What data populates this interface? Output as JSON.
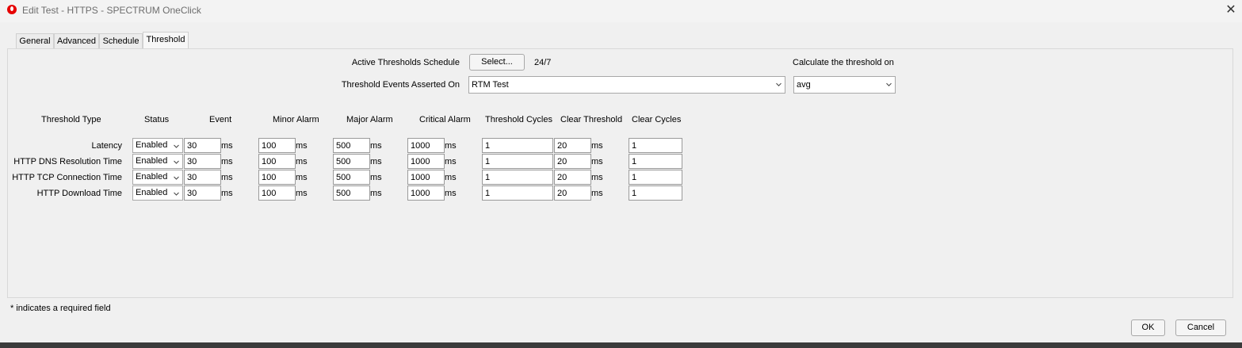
{
  "window": {
    "title": "Edit Test - HTTPS - SPECTRUM OneClick"
  },
  "tabs": [
    {
      "label": "General"
    },
    {
      "label": "Advanced"
    },
    {
      "label": "Schedule"
    },
    {
      "label": "Threshold",
      "active": true
    }
  ],
  "schedule": {
    "label": "Active Thresholds Schedule",
    "select_button": "Select...",
    "value": "24/7"
  },
  "asserted": {
    "label": "Threshold Events Asserted On",
    "value": "RTM Test"
  },
  "calculate": {
    "label": "Calculate the threshold on",
    "value": "avg"
  },
  "table": {
    "headers": {
      "type": "Threshold Type",
      "status": "Status",
      "event": "Event",
      "minor": "Minor Alarm",
      "major": "Major Alarm",
      "critical": "Critical Alarm",
      "cycles": "Threshold Cycles",
      "clear": "Clear Threshold",
      "clear_cycles": "Clear Cycles"
    },
    "unit": "ms",
    "rows": [
      {
        "type": "Latency",
        "status": "Enabled",
        "event": "30",
        "minor": "100",
        "major": "500",
        "critical": "1000",
        "cycles": "1",
        "clear": "20",
        "clear_cycles": "1"
      },
      {
        "type": "HTTP DNS Resolution Time",
        "status": "Enabled",
        "event": "30",
        "minor": "100",
        "major": "500",
        "critical": "1000",
        "cycles": "1",
        "clear": "20",
        "clear_cycles": "1"
      },
      {
        "type": "HTTP TCP Connection Time",
        "status": "Enabled",
        "event": "30",
        "minor": "100",
        "major": "500",
        "critical": "1000",
        "cycles": "1",
        "clear": "20",
        "clear_cycles": "1"
      },
      {
        "type": "HTTP Download Time",
        "status": "Enabled",
        "event": "30",
        "minor": "100",
        "major": "500",
        "critical": "1000",
        "cycles": "1",
        "clear": "20",
        "clear_cycles": "1"
      }
    ]
  },
  "footer": {
    "required_note": "* indicates a required field",
    "ok": "OK",
    "cancel": "Cancel"
  },
  "icons": {
    "app": "vodafone-logo-icon",
    "close": "close-icon",
    "dropdown": "chevron-down-icon"
  },
  "colors": {
    "background": "#f0f0f0",
    "brand": "#e60000"
  }
}
